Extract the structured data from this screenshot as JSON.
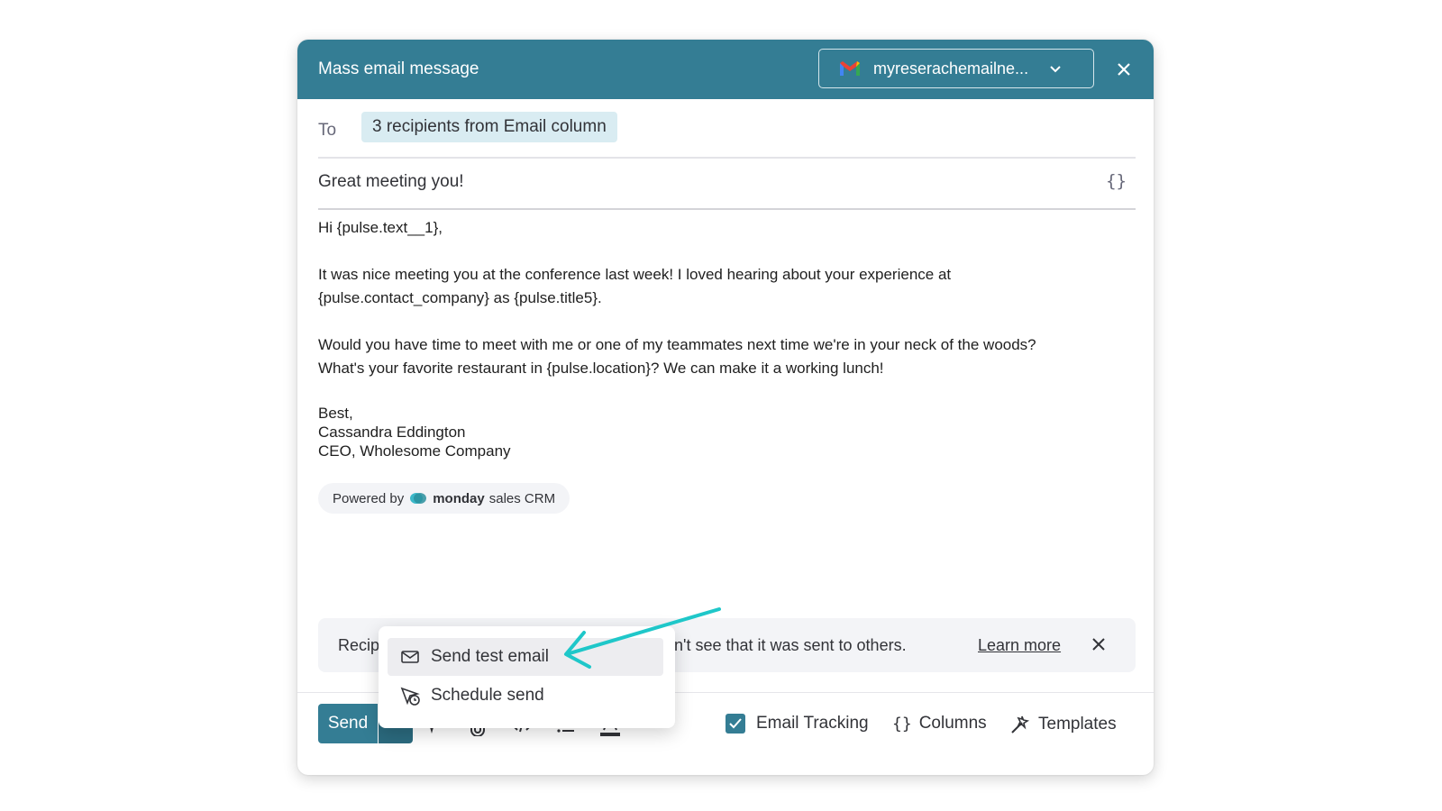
{
  "dialog": {
    "title": "Mass email message",
    "account": "myreserachemailne...",
    "to_label": "To",
    "recipients_chip": "3 recipients from Email column",
    "subject": "Great meeting you!",
    "subject_braces": "{}"
  },
  "body": {
    "greeting": "Hi {pulse.text__1},",
    "p1_line1": "It was nice meeting you at the conference last week! I loved hearing about your experience at",
    "p1_line2": "{pulse.contact_company} as {pulse.title5}.",
    "p2_line1": "Would you have time to meet with me or one of my teammates next time we're in your neck of the woods?",
    "p2_line2": "What's your favorite restaurant in {pulse.location}? We can make it a working lunch!",
    "sign_off": "Best,",
    "sig_name": "Cassandra Eddington",
    "sig_title": "CEO, Wholesome Company"
  },
  "powered": {
    "prefix": "Powered by",
    "brand": "monday",
    "suffix": "sales CRM"
  },
  "banner": {
    "text_left": "Recip",
    "text_right": "n't see that it was sent to others.",
    "learn_more": "Learn more"
  },
  "menu": {
    "items": [
      {
        "label": "Send test email",
        "icon": "mail-icon"
      },
      {
        "label": "Schedule send",
        "icon": "schedule-send-icon"
      }
    ]
  },
  "toolbar": {
    "send_label": "Send",
    "email_tracking_label": "Email Tracking",
    "email_tracking_checked": true,
    "columns_braces": "{}",
    "columns_label": "Columns",
    "templates_label": "Templates"
  },
  "colors": {
    "header": "#347d94",
    "chip": "#d9ecf2",
    "annotation_arrow": "#1fc7c9"
  }
}
